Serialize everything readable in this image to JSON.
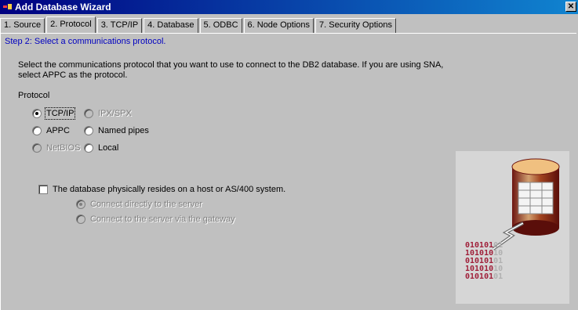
{
  "window": {
    "title": "Add Database Wizard",
    "close_symbol": "✕"
  },
  "tabs": [
    {
      "label": "1. Source",
      "active": false
    },
    {
      "label": "2. Protocol",
      "active": true
    },
    {
      "label": "3. TCP/IP",
      "active": false
    },
    {
      "label": "4. Database",
      "active": false
    },
    {
      "label": "5. ODBC",
      "active": false
    },
    {
      "label": "6. Node Options",
      "active": false
    },
    {
      "label": "7. Security Options",
      "active": false
    }
  ],
  "step": {
    "text": "Step 2: Select a communications protocol."
  },
  "description": {
    "line1": "Select the communications protocol that you want to use to connect to the DB2 database.  If you are using SNA,",
    "line2": "select APPC as the protocol."
  },
  "protocol": {
    "label": "Protocol",
    "options": {
      "tcpip": {
        "label": "TCP/IP",
        "checked": true,
        "enabled": true
      },
      "ipxspx": {
        "label": "IPX/SPX",
        "checked": false,
        "enabled": false
      },
      "appc": {
        "label": "APPC",
        "checked": false,
        "enabled": true
      },
      "named_pipes": {
        "label": "Named pipes",
        "checked": false,
        "enabled": true
      },
      "netbios": {
        "label": "NetBIOS",
        "checked": false,
        "enabled": false
      },
      "local": {
        "label": "Local",
        "checked": false,
        "enabled": true
      }
    }
  },
  "host_option": {
    "checkbox_label": "The database physically resides on a host or AS/400 system.",
    "checked": false,
    "connect_directly": {
      "label": "Connect directly to the server",
      "checked": true,
      "enabled": false
    },
    "via_gateway": {
      "label": "Connect to the server via the gateway",
      "checked": false,
      "enabled": false
    }
  },
  "graphic": {
    "binary_rows": [
      "010101",
      "101010",
      "010101",
      "101010",
      "010101"
    ],
    "binary_faded": [
      "01",
      "10",
      "01",
      "10",
      "01"
    ]
  },
  "colors": {
    "titlebar": "#000080",
    "step_text": "#0000c0",
    "binary_text": "#a0203a"
  }
}
